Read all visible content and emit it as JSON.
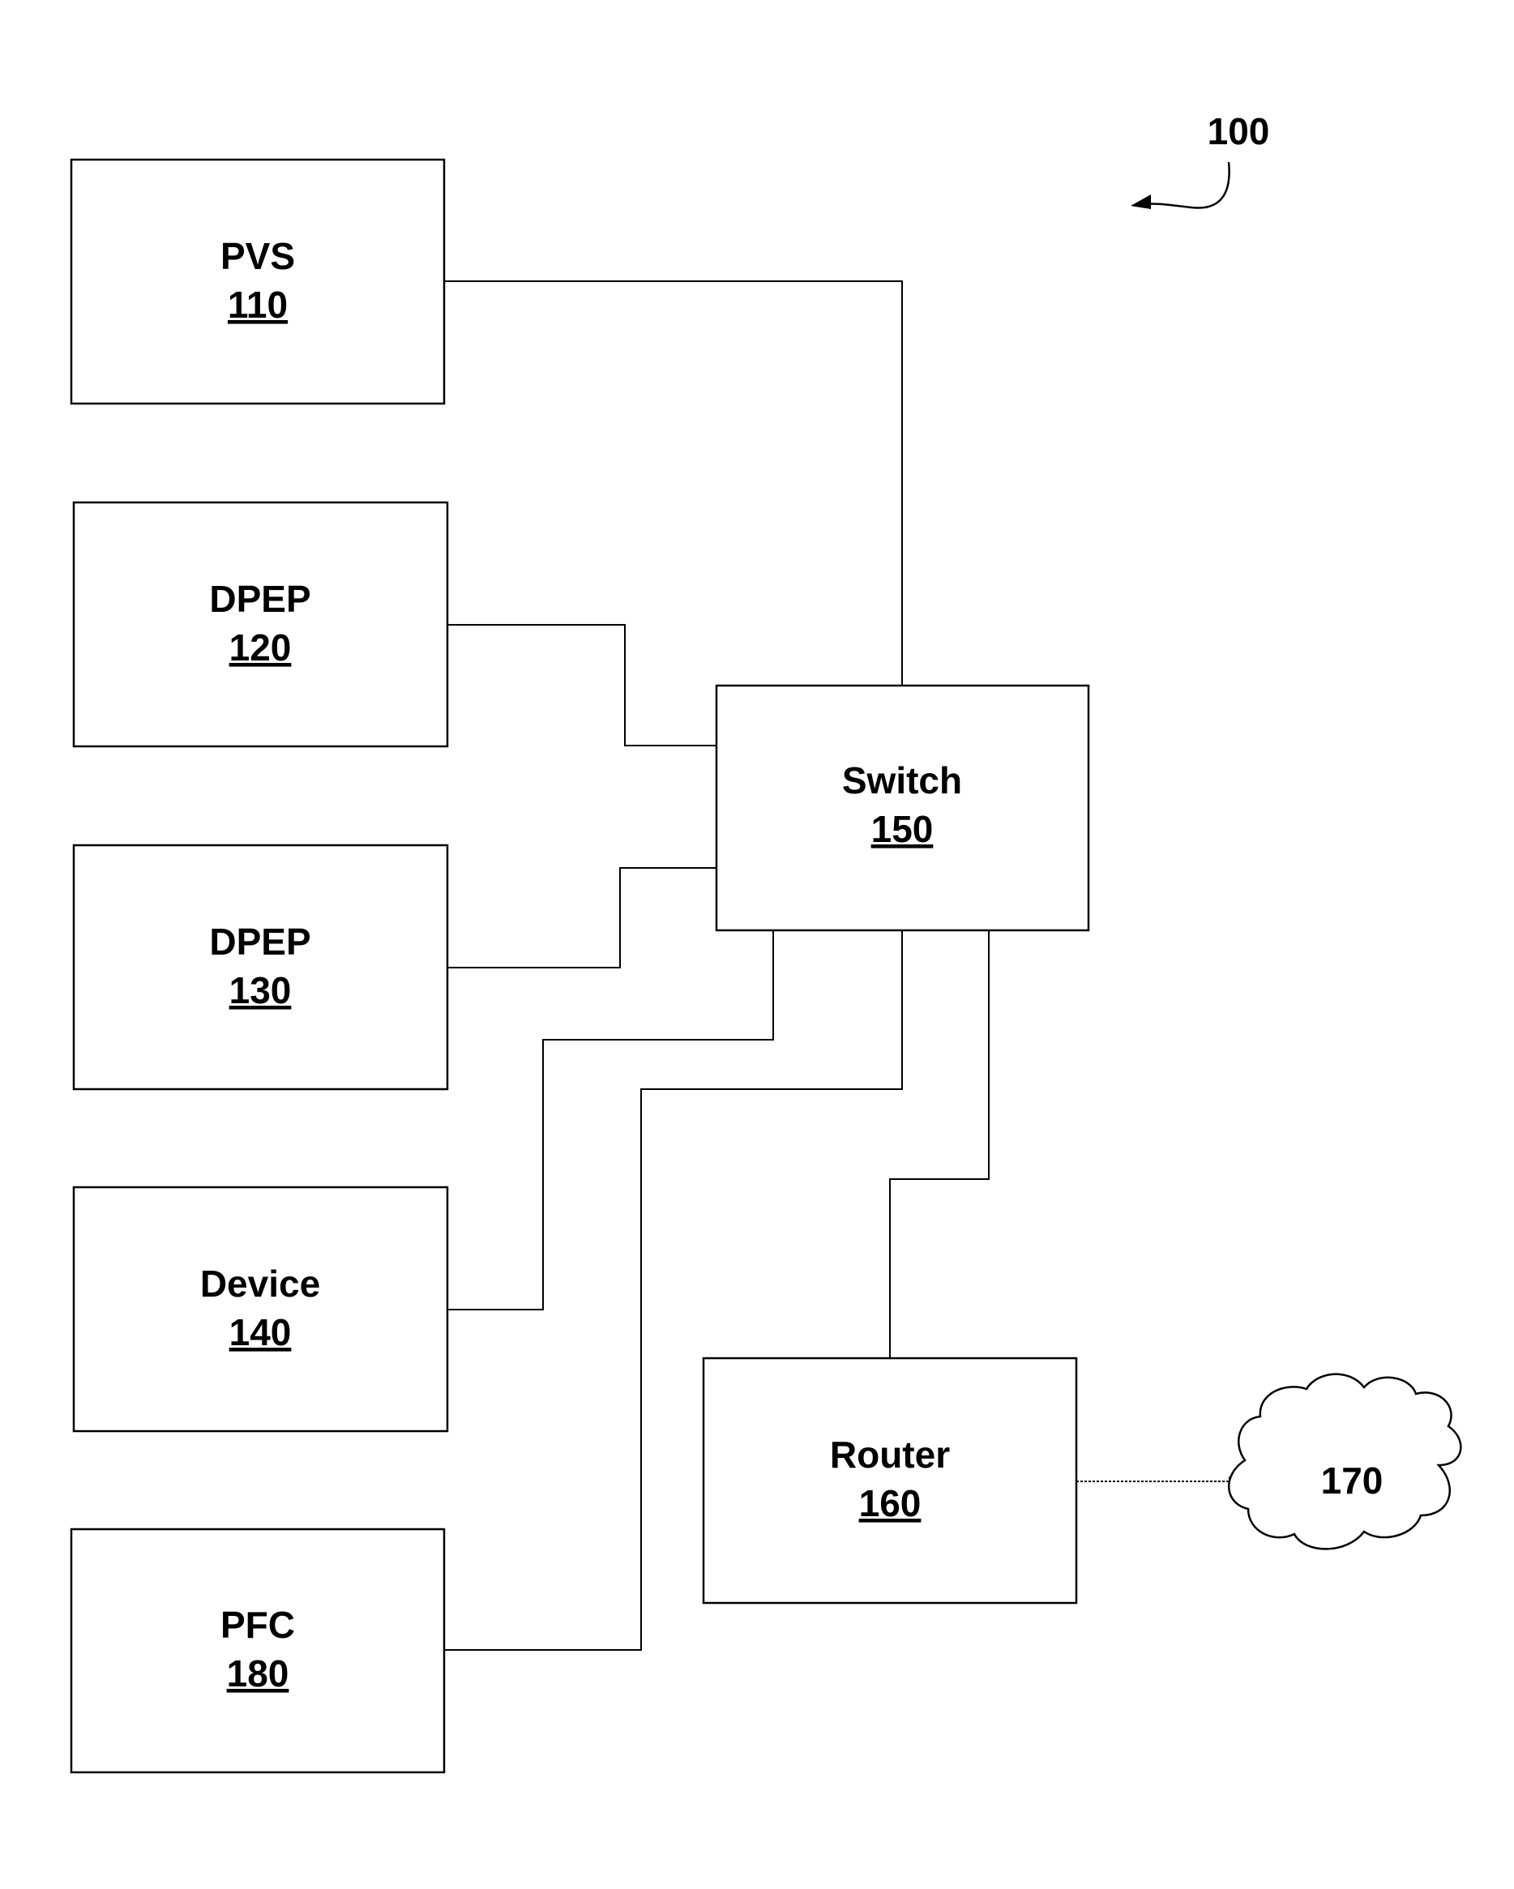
{
  "figure": {
    "reference": "100",
    "nodes": [
      {
        "id": "pvs",
        "label": "PVS",
        "number": "110"
      },
      {
        "id": "dpep1",
        "label": "DPEP",
        "number": "120"
      },
      {
        "id": "dpep2",
        "label": "DPEP",
        "number": "130"
      },
      {
        "id": "device",
        "label": "Device",
        "number": "140"
      },
      {
        "id": "switch",
        "label": "Switch",
        "number": "150"
      },
      {
        "id": "router",
        "label": "Router",
        "number": "160"
      },
      {
        "id": "network",
        "label": "",
        "number": "170"
      },
      {
        "id": "pfc",
        "label": "PFC",
        "number": "180"
      }
    ],
    "connections": [
      {
        "from": "110",
        "to": "150"
      },
      {
        "from": "120",
        "to": "150"
      },
      {
        "from": "130",
        "to": "150"
      },
      {
        "from": "140",
        "to": "150"
      },
      {
        "from": "180",
        "to": "150"
      },
      {
        "from": "150",
        "to": "160"
      },
      {
        "from": "160",
        "to": "170",
        "arrow": true
      }
    ]
  }
}
